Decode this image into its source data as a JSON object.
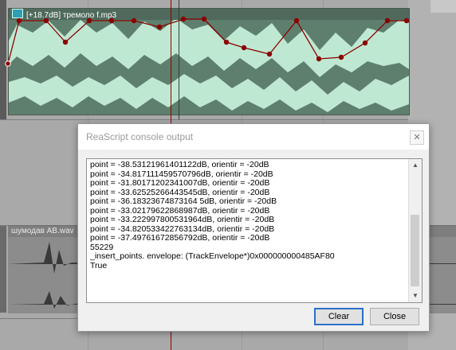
{
  "tracks": [
    {
      "item_label": "[+18.7dB] тремоло f.mp3",
      "color": "#5f7f6e",
      "envelope_color": "#8b0000"
    },
    {
      "item_label": "шумодав AB.wav",
      "color": "#8c8c8c"
    }
  ],
  "dialog": {
    "title": "ReaScript console output",
    "lines": [
      "point = -38.53121961401122dB, orientir = -20dB",
      "point = -34.817111459570796dB, orientir = -20dB",
      "point = -31.80171202341007dB, orientir = -20dB",
      "point = -33.62525266443545dB, orientir = -20dB",
      "point = -36.18323674873164 5dB, orientir = -20dB",
      "point = -33.02179622868987dB, orientir = -20dB",
      "point = -33.222997800531964dB, orientir = -20dB",
      "point = -34.820533422763134dB, orientir = -20dB",
      "point = -37.49761672856792dB, orientir = -20dB",
      "55229",
      "_insert_points. envelope: (TrackEnvelope*)0x000000000485AF80",
      "True"
    ],
    "clear_label": "Clear",
    "close_label": "Close"
  }
}
